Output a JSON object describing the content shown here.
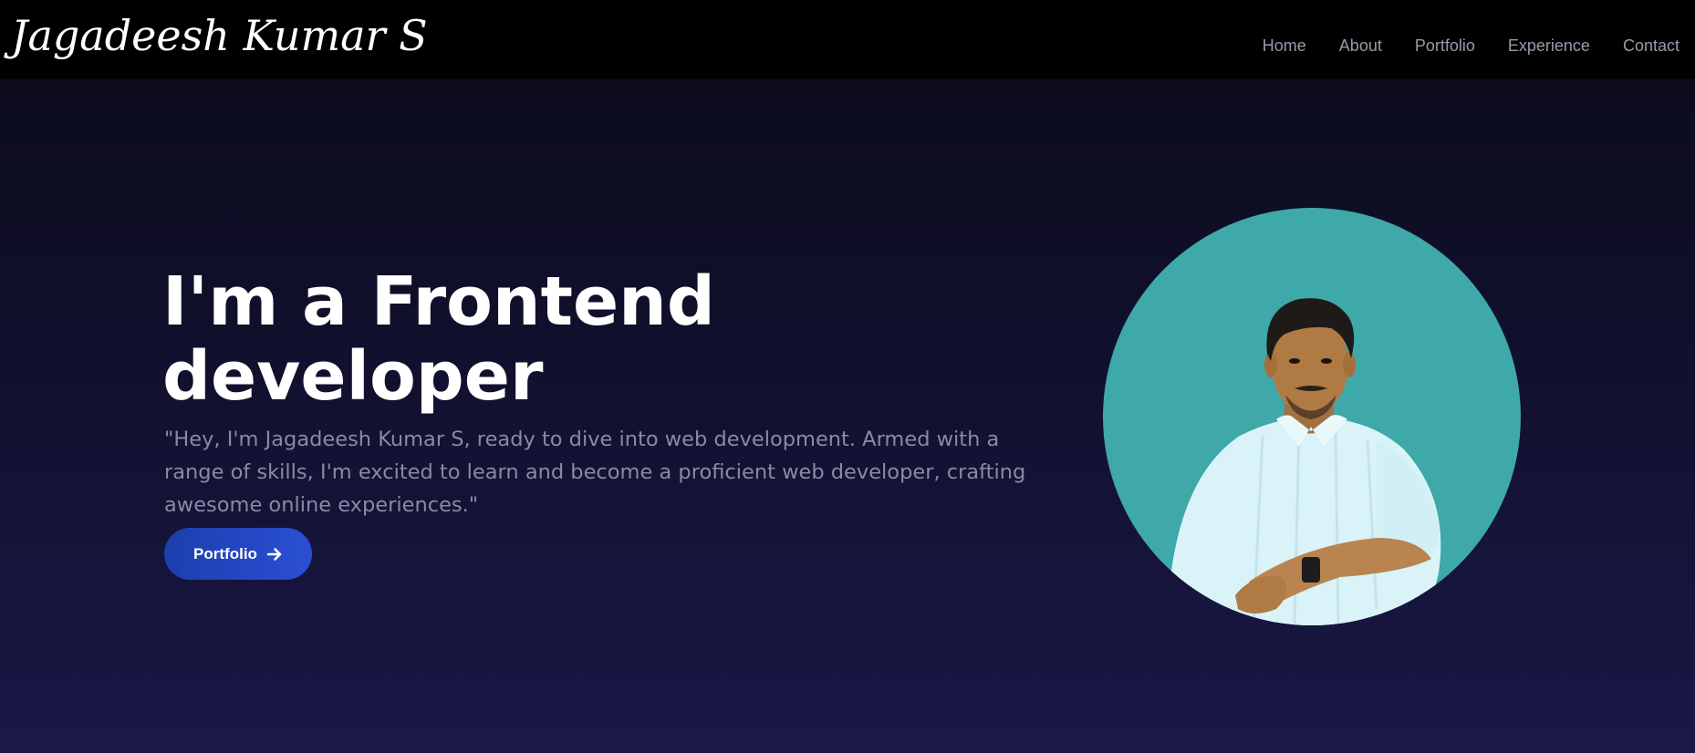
{
  "header": {
    "logo_text": "Jagadeesh Kumar S",
    "nav": [
      {
        "label": "Home"
      },
      {
        "label": "About"
      },
      {
        "label": "Portfolio"
      },
      {
        "label": "Experience"
      },
      {
        "label": "Contact"
      }
    ]
  },
  "hero": {
    "title_line1": "I'm a Frontend",
    "title_line2": "developer",
    "description": "\"Hey, I'm Jagadeesh Kumar S, ready to dive into web development. Armed with a range of skills, I'm excited to learn and become a proficient web developer, crafting awesome online experiences.\"",
    "button_label": "Portfolio",
    "button_icon": "arrow-right-icon",
    "avatar_icon": "profile-photo"
  },
  "colors": {
    "nav_background": "#000000",
    "page_gradient_top": "#0b0b18",
    "page_gradient_bottom": "#1a1846",
    "nav_text": "#9a9aac",
    "description_text": "#8a8aa2",
    "button_background": "#2a4fd3",
    "avatar_background": "#3fa8a8"
  }
}
